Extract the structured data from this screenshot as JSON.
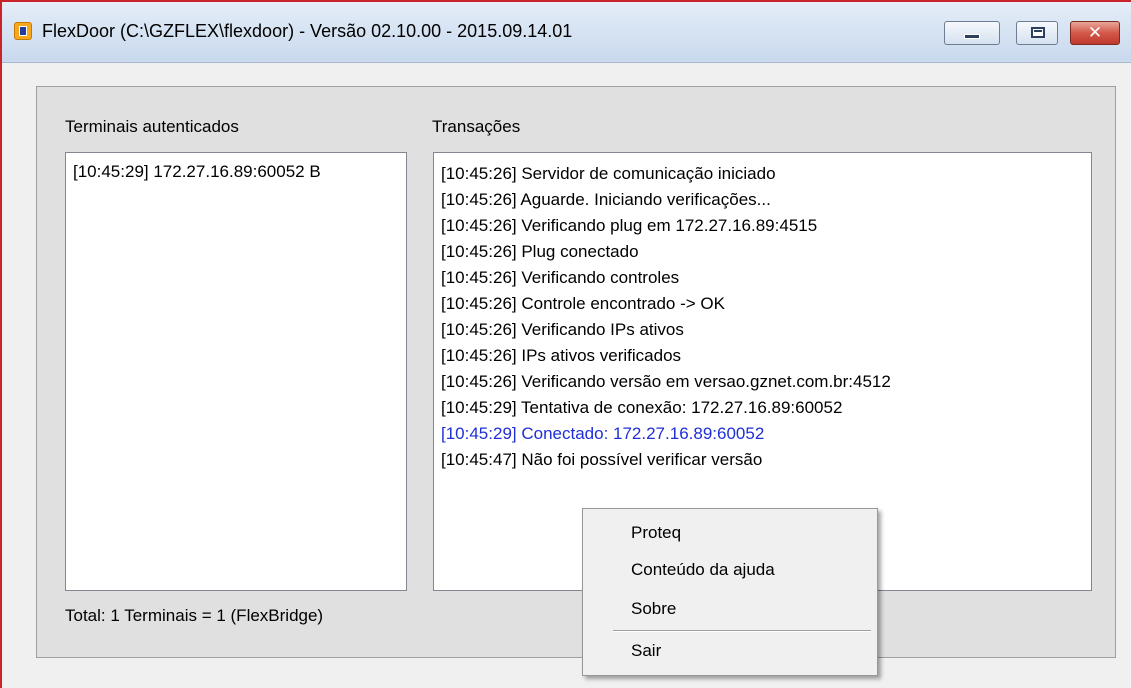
{
  "window": {
    "title": "FlexDoor (C:\\GZFLEX\\flexdoor) - Versão 02.10.00 - 2015.09.14.01",
    "icon": "app-icon",
    "buttons": {
      "minimize": "minimize-icon",
      "maximize": "maximize-icon",
      "close": "✕"
    },
    "accent_color": "#c8242a"
  },
  "terminals": {
    "heading": "Terminais autenticados",
    "items": [
      "[10:45:29] 172.27.16.89:60052 B"
    ],
    "total": "Total: 1 Terminais = 1 (FlexBridge)"
  },
  "transactions": {
    "heading": "Transações",
    "items": [
      "[10:45:26] Servidor de comunicação iniciado",
      "[10:45:26] Aguarde. Iniciando verificações...",
      "[10:45:26] Verificando plug em 172.27.16.89:4515",
      "[10:45:26] Plug conectado",
      "[10:45:26] Verificando controles",
      "[10:45:26] Controle encontrado -> OK",
      "[10:45:26] Verificando IPs ativos",
      "[10:45:26] IPs ativos verificados",
      "[10:45:26] Verificando versão em versao.gznet.com.br:4512",
      "[10:45:29] Tentativa de conexão: 172.27.16.89:60052",
      "[10:45:29] Conectado: 172.27.16.89:60052",
      "[10:45:47] Não foi possível verificar versão"
    ],
    "highlight_color": "#1f2fd6"
  },
  "context_menu": {
    "items": [
      "Proteq",
      "Conteúdo da ajuda",
      "Sobre",
      "Sair"
    ]
  }
}
